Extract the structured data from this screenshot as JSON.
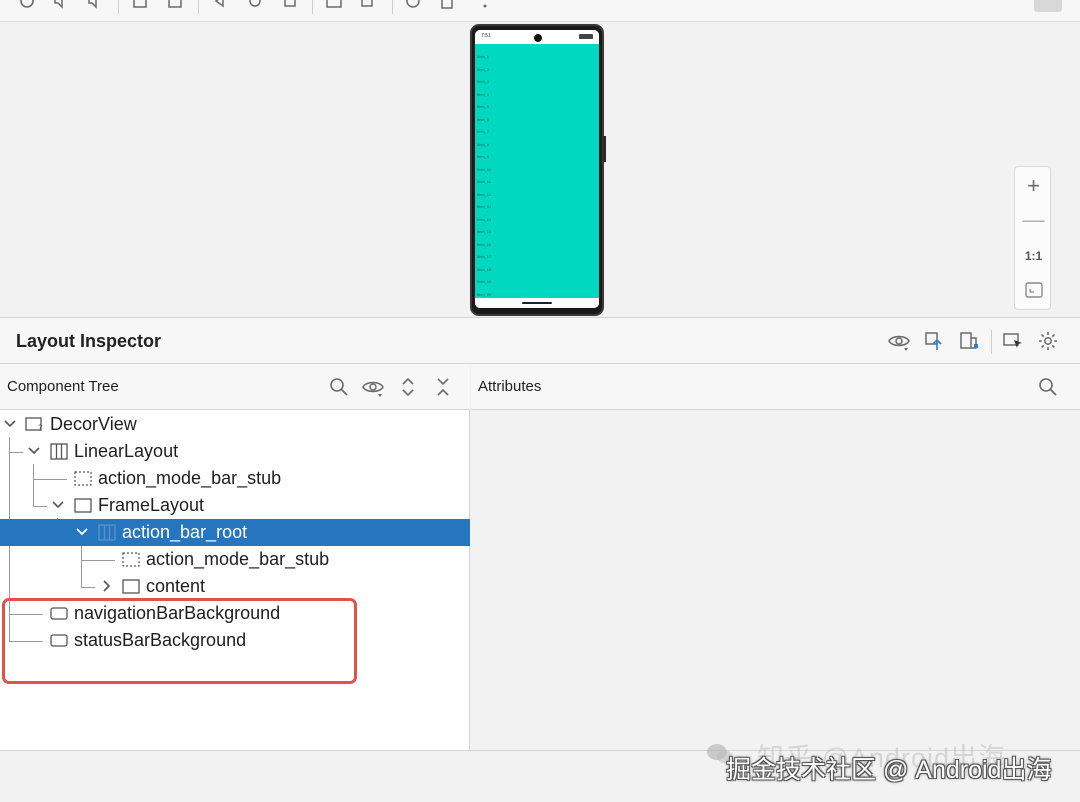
{
  "device_preview": {
    "status_time": "7:51",
    "rows": [
      "item_1",
      "item_2",
      "item_3",
      "item_4",
      "item_5",
      "item_6",
      "item_7",
      "item_8",
      "item_9",
      "item_10",
      "item_11",
      "item_12",
      "item_13",
      "item_14",
      "item_15",
      "item_16",
      "item_17",
      "item_18",
      "item_19",
      "item_20"
    ],
    "screen_color": "#00d9c0"
  },
  "zoom": {
    "zoom_in": "+",
    "zoom_out": "—",
    "actual_size": "1:1"
  },
  "layout_inspector": {
    "title": "Layout Inspector",
    "header_icons": [
      "eye-icon",
      "export-icon",
      "snapshot-icon",
      "select-icon",
      "gear-icon"
    ]
  },
  "component_tree": {
    "label": "Component Tree",
    "nodes": [
      {
        "label": "DecorView",
        "icon": "unknown-view-icon"
      },
      {
        "label": "LinearLayout",
        "icon": "linear-layout-icon"
      },
      {
        "label": "action_mode_bar_stub",
        "icon": "stub-icon"
      },
      {
        "label": "FrameLayout",
        "icon": "frame-layout-icon"
      },
      {
        "label": "action_bar_root",
        "icon": "linear-layout-icon",
        "selected": true
      },
      {
        "label": "action_mode_bar_stub",
        "icon": "stub-icon"
      },
      {
        "label": "content",
        "icon": "frame-layout-icon"
      },
      {
        "label": "navigationBarBackground",
        "icon": "view-icon"
      },
      {
        "label": "statusBarBackground",
        "icon": "view-icon"
      }
    ]
  },
  "attributes": {
    "label": "Attributes"
  },
  "watermark": {
    "text": "掘金技术社区 @ Android出海",
    "ghost_text": "知乎 @Android出海"
  },
  "colors": {
    "selection": "#2675bf",
    "highlight_box": "#e0534d",
    "accent_phone": "#00d9c0"
  }
}
